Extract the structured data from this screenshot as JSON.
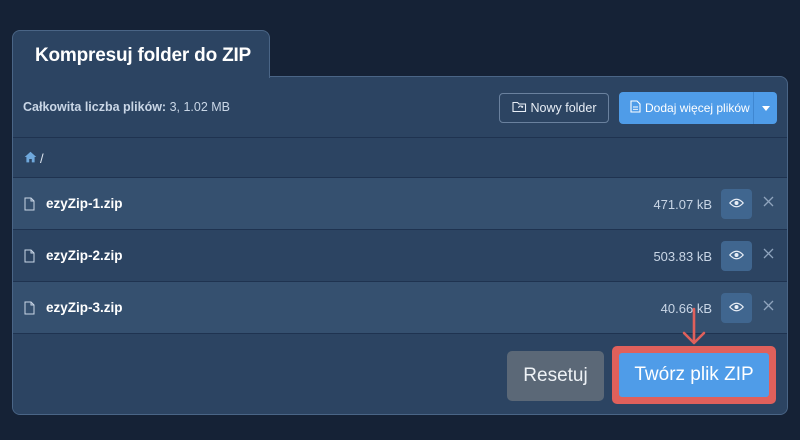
{
  "tab": {
    "title": "Kompresuj folder do ZIP"
  },
  "summary": {
    "label": "Całkowita liczba plików:",
    "value": " 3, 1.02 MB"
  },
  "toolbar": {
    "new_folder_label": "Nowy folder",
    "add_files_label": "Dodaj więcej plików"
  },
  "breadcrumb": {
    "path": "/"
  },
  "files": [
    {
      "name": "ezyZip-1.zip",
      "size": "471.07 kB"
    },
    {
      "name": "ezyZip-2.zip",
      "size": "503.83 kB"
    },
    {
      "name": "ezyZip-3.zip",
      "size": "40.66 kB"
    }
  ],
  "footer": {
    "reset_label": "Resetuj",
    "create_label": "Twórz plik ZIP"
  },
  "icons": {
    "new_folder": "folder-sync-icon",
    "add_files": "file-icon",
    "home": "home-icon",
    "file": "file-icon",
    "preview": "eye-icon",
    "remove": "close-icon",
    "dropdown": "caret-down-icon",
    "annotation": "arrow-down-icon"
  },
  "colors": {
    "primary": "#4f9ce8",
    "highlight": "#e0605b",
    "background": "#152236",
    "panel": "#2c4462"
  }
}
